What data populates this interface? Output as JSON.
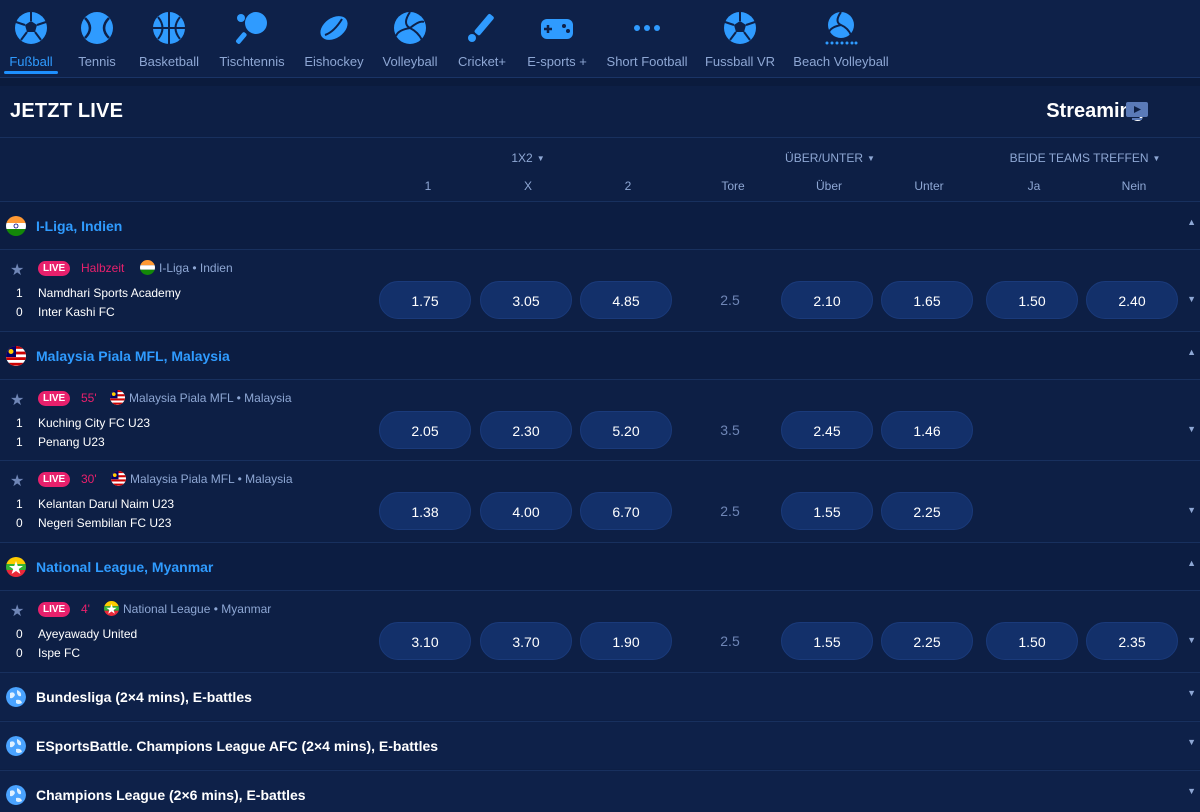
{
  "nav": {
    "sports": [
      {
        "label": "Fußball",
        "icon": "soccer-ball-icon",
        "active": true
      },
      {
        "label": "Tennis",
        "icon": "tennis-ball-icon"
      },
      {
        "label": "Basketball",
        "icon": "basketball-icon"
      },
      {
        "label": "Tischtennis",
        "icon": "table-tennis-icon"
      },
      {
        "label": "Eishockey",
        "icon": "hockey-puck-icon"
      },
      {
        "label": "Volleyball",
        "icon": "volleyball-icon"
      },
      {
        "label": "Cricket+",
        "icon": "cricket-bat-icon"
      },
      {
        "label": "E-sports +",
        "icon": "gamepad-icon"
      },
      {
        "label": "Short Football",
        "icon": "dots-icon"
      },
      {
        "label": "Fussball VR",
        "icon": "soccer-ball-vr-icon"
      },
      {
        "label": "Beach Volleyball",
        "icon": "beach-volleyball-icon"
      }
    ]
  },
  "header": {
    "title": "JETZT LIVE",
    "streaming": "Streaming"
  },
  "columns": {
    "group_1x2": "1X2",
    "group_ou": "ÜBER/UNTER",
    "group_btts": "BEIDE TEAMS TREFFEN",
    "h1": "1",
    "hx": "X",
    "h2": "2",
    "tore": "Tore",
    "ueber": "Über",
    "unter": "Unter",
    "ja": "Ja",
    "nein": "Nein"
  },
  "leagues": [
    {
      "name": "I-Liga, Indien"
    },
    {
      "name": "Malaysia Piala MFL, Malaysia"
    },
    {
      "name": "National League, Myanmar"
    },
    {
      "name": "Bundesliga (2×4 mins), E-battles"
    },
    {
      "name": "ESportsBattle. Champions League AFC (2×4 mins), E-battles"
    },
    {
      "name": "Champions League (2×6 mins), E-battles"
    }
  ],
  "matches": [
    {
      "live": "LIVE",
      "phase": "Halbzeit",
      "league": "I-Liga",
      "country": "Indien",
      "home_score": "1",
      "home": "Namdhari Sports Academy",
      "away_score": "0",
      "away": "Inter Kashi FC",
      "o1": "1.75",
      "ox": "3.05",
      "o2": "4.85",
      "tore": "2.5",
      "ueber": "2.10",
      "unter": "1.65",
      "ja": "1.50",
      "nein": "2.40"
    },
    {
      "live": "LIVE",
      "phase": "55'",
      "league": "Malaysia Piala MFL",
      "country": "Malaysia",
      "home_score": "1",
      "home": "Kuching City FC U23",
      "away_score": "1",
      "away": "Penang U23",
      "o1": "2.05",
      "ox": "2.30",
      "o2": "5.20",
      "tore": "3.5",
      "ueber": "2.45",
      "unter": "1.46"
    },
    {
      "live": "LIVE",
      "phase": "30'",
      "league": "Malaysia Piala MFL",
      "country": "Malaysia",
      "home_score": "1",
      "home": "Kelantan Darul Naim U23",
      "away_score": "0",
      "away": "Negeri Sembilan FC U23",
      "o1": "1.38",
      "ox": "4.00",
      "o2": "6.70",
      "tore": "2.5",
      "ueber": "1.55",
      "unter": "2.25"
    },
    {
      "live": "LIVE",
      "phase": "4'",
      "league": "National League",
      "country": "Myanmar",
      "home_score": "0",
      "home": "Ayeyawady United",
      "away_score": "0",
      "away": "Ispe FC",
      "o1": "3.10",
      "ox": "3.70",
      "o2": "1.90",
      "tore": "2.5",
      "ueber": "1.55",
      "unter": "2.25",
      "ja": "1.50",
      "nein": "2.35"
    }
  ],
  "sep": "•",
  "colors": {
    "accent": "#2f9bff",
    "live": "#e8206c",
    "odd_bg": "#13306a",
    "bg": "#0b1b3d"
  }
}
